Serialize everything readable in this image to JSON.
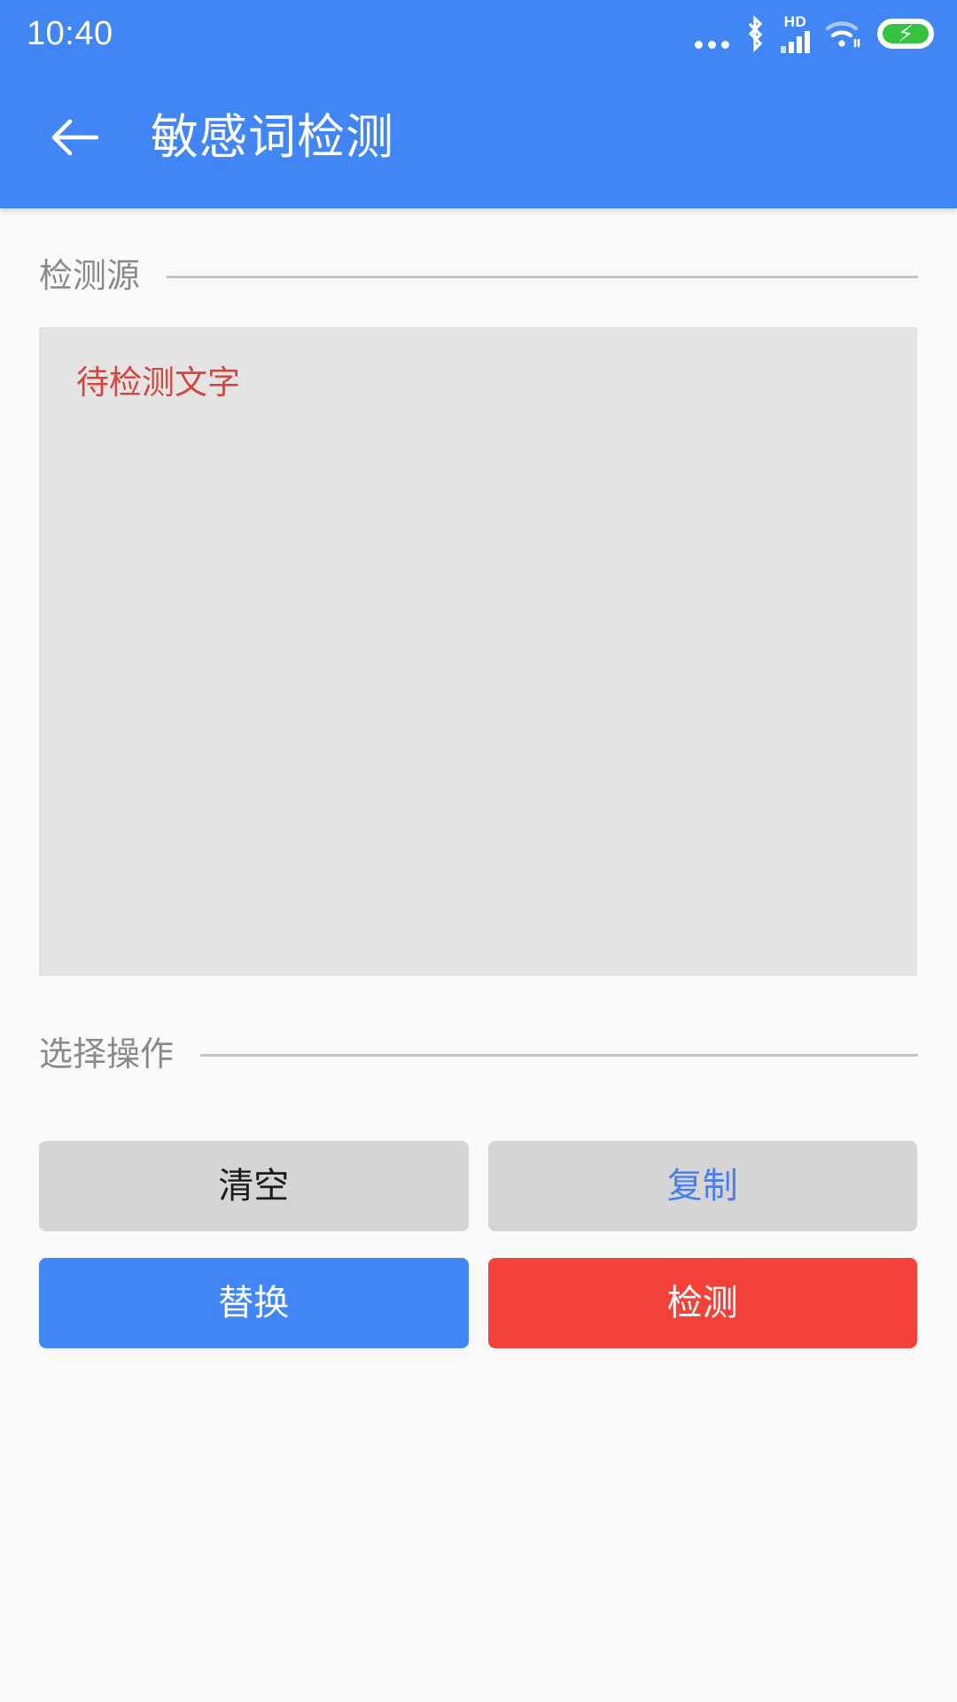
{
  "status_bar": {
    "time": "10:40",
    "icons": [
      {
        "name": "more-dots-icon"
      },
      {
        "name": "bluetooth-icon"
      },
      {
        "name": "hd-signal-icon",
        "label": "HD"
      },
      {
        "name": "wifi-icon"
      },
      {
        "name": "battery-charging-icon"
      }
    ]
  },
  "app_bar": {
    "back_label": "←",
    "title": "敏感词检测"
  },
  "sections": {
    "source": {
      "title": "检测源",
      "textarea": {
        "value": "",
        "placeholder": "待检测文字"
      }
    },
    "operations": {
      "title": "选择操作",
      "buttons": [
        {
          "label": "清空",
          "style": "secondary-dark"
        },
        {
          "label": "复制",
          "style": "secondary-blue"
        },
        {
          "label": "替换",
          "style": "primary-blue"
        },
        {
          "label": "检测",
          "style": "primary-red"
        }
      ]
    }
  },
  "colors": {
    "accent_blue": "#4285f4",
    "danger_red": "#f4423a",
    "placeholder_red": "#d8453a",
    "button_gray": "#d5d5d5",
    "textarea_bg": "#e4e4e4",
    "page_bg": "#fafafa",
    "battery_green": "#34c240"
  }
}
